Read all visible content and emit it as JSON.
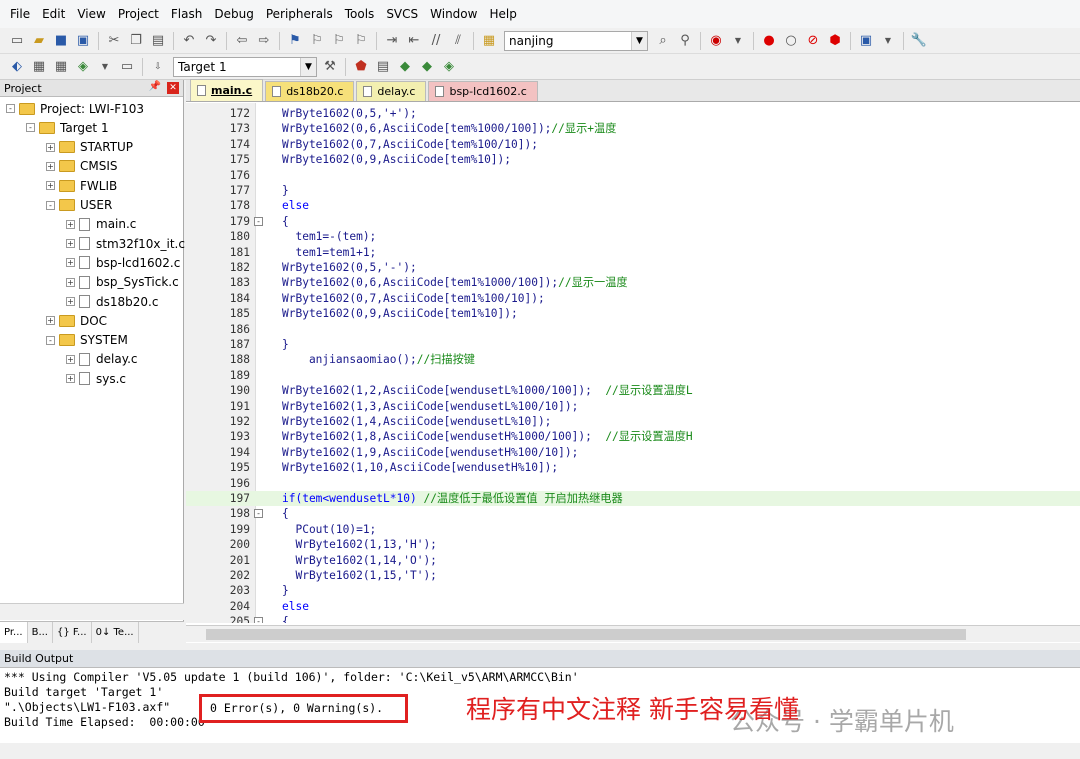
{
  "menu": [
    "File",
    "Edit",
    "View",
    "Project",
    "Flash",
    "Debug",
    "Peripherals",
    "Tools",
    "SVCS",
    "Window",
    "Help"
  ],
  "toolbar": {
    "find_combo": "nanjing",
    "target_combo": "Target 1"
  },
  "project": {
    "panel_title": "Project",
    "root": "Project: LWI-F103",
    "target": "Target 1",
    "groups": [
      "STARTUP",
      "CMSIS",
      "FWLIB",
      "USER",
      "DOC",
      "SYSTEM"
    ],
    "user_files": [
      "main.c",
      "stm32f10x_it.c",
      "bsp-lcd1602.c",
      "bsp_SysTick.c",
      "ds18b20.c"
    ],
    "system_files": [
      "delay.c",
      "sys.c"
    ],
    "bottom_tabs": [
      "Pr...",
      "B...",
      "{} F...",
      "0↓ Te..."
    ]
  },
  "tabs": [
    {
      "label": "main.c",
      "color": "#fbf7c9"
    },
    {
      "label": "ds18b20.c",
      "color": "#f6e07a"
    },
    {
      "label": "delay.c",
      "color": "#f3efb0"
    },
    {
      "label": "bsp-lcd1602.c",
      "color": "#f3c2c2"
    }
  ],
  "code": [
    {
      "n": "172",
      "t": "WrByte1602(0,5,'+');",
      "c": ""
    },
    {
      "n": "173",
      "t": "WrByte1602(0,6,AsciiCode[tem%1000/100]);",
      "c": "//显示+温度"
    },
    {
      "n": "174",
      "t": "WrByte1602(0,7,AsciiCode[tem%100/10]);",
      "c": ""
    },
    {
      "n": "175",
      "t": "WrByte1602(0,9,AsciiCode[tem%10]);",
      "c": ""
    },
    {
      "n": "176",
      "t": "",
      "c": ""
    },
    {
      "n": "177",
      "t": "}",
      "c": ""
    },
    {
      "n": "178",
      "t": "else",
      "c": ""
    },
    {
      "n": "179",
      "t": "{",
      "c": ""
    },
    {
      "n": "180",
      "t": "  tem1=-(tem);",
      "c": ""
    },
    {
      "n": "181",
      "t": "  tem1=tem1+1;",
      "c": ""
    },
    {
      "n": "182",
      "t": "WrByte1602(0,5,'-');",
      "c": ""
    },
    {
      "n": "183",
      "t": "WrByte1602(0,6,AsciiCode[tem1%1000/100]);",
      "c": "//显示一温度"
    },
    {
      "n": "184",
      "t": "WrByte1602(0,7,AsciiCode[tem1%100/10]);",
      "c": ""
    },
    {
      "n": "185",
      "t": "WrByte1602(0,9,AsciiCode[tem1%10]);",
      "c": ""
    },
    {
      "n": "186",
      "t": "",
      "c": ""
    },
    {
      "n": "187",
      "t": "}",
      "c": ""
    },
    {
      "n": "188",
      "t": "    anjiansaomiao();",
      "c": "//扫描按键"
    },
    {
      "n": "189",
      "t": "",
      "c": ""
    },
    {
      "n": "190",
      "t": "WrByte1602(1,2,AsciiCode[wendusetL%1000/100]);  ",
      "c": "//显示设置温度L"
    },
    {
      "n": "191",
      "t": "WrByte1602(1,3,AsciiCode[wendusetL%100/10]);",
      "c": ""
    },
    {
      "n": "192",
      "t": "WrByte1602(1,4,AsciiCode[wendusetL%10]);",
      "c": ""
    },
    {
      "n": "193",
      "t": "WrByte1602(1,8,AsciiCode[wendusetH%1000/100]);  ",
      "c": "//显示设置温度H"
    },
    {
      "n": "194",
      "t": "WrByte1602(1,9,AsciiCode[wendusetH%100/10]);",
      "c": ""
    },
    {
      "n": "195",
      "t": "WrByte1602(1,10,AsciiCode[wendusetH%10]);",
      "c": ""
    },
    {
      "n": "196",
      "t": "",
      "c": ""
    },
    {
      "n": "197",
      "t": "if(tem<wendusetL*10) ",
      "c": "//温度低于最低设置值 开启加热继电器"
    },
    {
      "n": "198",
      "t": "{",
      "c": ""
    },
    {
      "n": "199",
      "t": "  PCout(10)=1;",
      "c": ""
    },
    {
      "n": "200",
      "t": "  WrByte1602(1,13,'H');",
      "c": ""
    },
    {
      "n": "201",
      "t": "  WrByte1602(1,14,'O');",
      "c": ""
    },
    {
      "n": "202",
      "t": "  WrByte1602(1,15,'T');",
      "c": ""
    },
    {
      "n": "203",
      "t": "}",
      "c": ""
    },
    {
      "n": "204",
      "t": "else",
      "c": ""
    },
    {
      "n": "205",
      "t": "{",
      "c": ""
    }
  ],
  "build": {
    "title": "Build Output",
    "lines": [
      "*** Using Compiler 'V5.05 update 1 (build 106)', folder: 'C:\\Keil_v5\\ARM\\ARMCC\\Bin'",
      "Build target 'Target 1'",
      "\".\\Objects\\LW1-F103.axf\"",
      "Build Time Elapsed:  00:00:00"
    ],
    "result": "0 Error(s), 0 Warning(s).",
    "annotation": "程序有中文注释 新手容易看懂",
    "watermark": "公众号 · 学霸单片机"
  }
}
